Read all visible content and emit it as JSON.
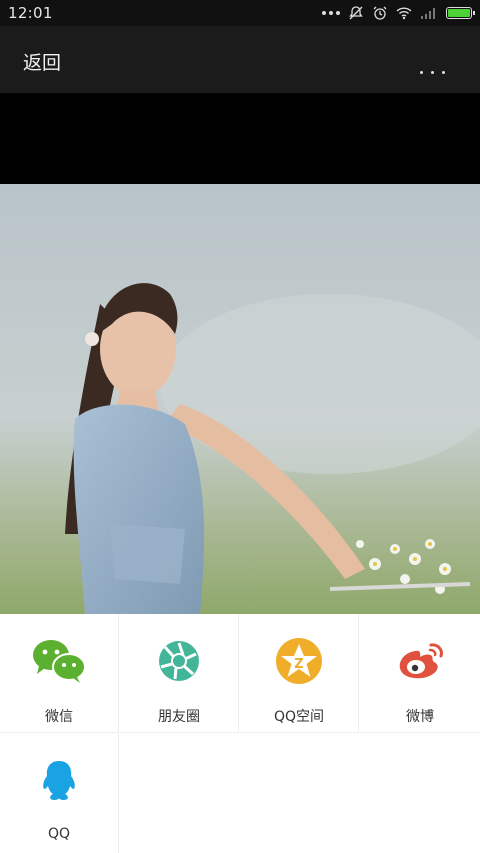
{
  "status_bar": {
    "time": "12:01"
  },
  "app_bar": {
    "back_label": "返回"
  },
  "share": {
    "items": [
      {
        "label": "微信",
        "icon": "wechat-icon",
        "color": "#5cb030"
      },
      {
        "label": "朋友圈",
        "icon": "moments-icon",
        "color": "#43b69a"
      },
      {
        "label": "QQ空间",
        "icon": "qzone-icon",
        "color": "#f0ad2a"
      },
      {
        "label": "微博",
        "icon": "weibo-icon",
        "color": "#e0523e"
      },
      {
        "label": "QQ",
        "icon": "qq-icon",
        "color": "#1aa3e3"
      }
    ]
  }
}
